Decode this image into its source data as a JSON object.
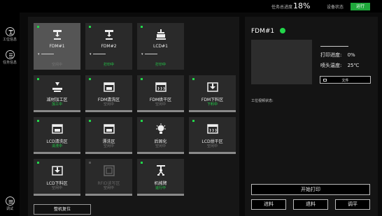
{
  "topbar": {
    "progress_label": "任务总进度",
    "progress_value": "18%",
    "status_label": "设备状态",
    "status_value": "运行",
    "status_color": "#1fa83b"
  },
  "sidebar": {
    "items": [
      {
        "label": "工位信息",
        "icon": "printer-station-icon"
      },
      {
        "label": "任务信息",
        "icon": "task-list-icon"
      },
      {
        "label": "调试",
        "icon": "debug-menu-icon"
      }
    ]
  },
  "stations": {
    "fdm1": {
      "name": "FDM#1",
      "status": "空闲中",
      "line_icon": "fdm-icon"
    },
    "fdm2": {
      "name": "FDM#2",
      "status": "打印中",
      "line_icon": "fdm-icon"
    },
    "lcd1": {
      "name": "LCD#1",
      "status": "打印中",
      "line_icon": "lcd-icon"
    },
    "subtractive": {
      "name": "减材加工区",
      "status": "加工中"
    },
    "fdm_wash": {
      "name": "FDM清洗区",
      "status": "空闲中"
    },
    "fdm_dry": {
      "name": "FDM烘干区",
      "status": "空闲中"
    },
    "fdm_unload": {
      "name": "FDM下料区",
      "status": "下料中"
    },
    "lcd_wash": {
      "name": "LCD清洗区",
      "status": "清洗中"
    },
    "rinse": {
      "name": "漂洗区",
      "status": "空闲中"
    },
    "post_cure": {
      "name": "后固化",
      "status": "空闲中"
    },
    "lcd_dry": {
      "name": "LCD烘干区",
      "status": "空闲中"
    },
    "lcd_unload": {
      "name": "LCD下料区",
      "status": "空闲中"
    },
    "rfid": {
      "name": "RFID读写区",
      "status": "空闲中"
    },
    "robot_arm": {
      "name": "机械臂",
      "status": "运行中"
    }
  },
  "reset_button": "整机复位",
  "panel": {
    "device_title": "FDM#1",
    "progress_label": "打印进度:",
    "progress_value": "0%",
    "nozzle_label": "喷头温度:",
    "nozzle_value": "25℃",
    "file_button": "文件",
    "video_label": "工位视频状态:",
    "start_button": "开始打印",
    "feed_button": "进料",
    "retract_button": "退料",
    "level_button": "调平"
  },
  "colors": {
    "accent_green": "#22d64a",
    "status_green": "#1fa83b"
  }
}
